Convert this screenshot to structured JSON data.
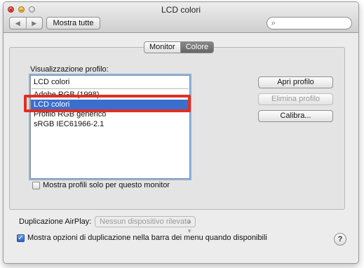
{
  "window": {
    "title": "LCD colori"
  },
  "toolbar": {
    "back_icon": "triangle-left",
    "forward_icon": "triangle-right",
    "show_all_label": "Mostra tutte",
    "search_placeholder": "",
    "search_icon": "magnifier"
  },
  "tabs": {
    "items": [
      {
        "label": "Monitor"
      },
      {
        "label": "Colore"
      }
    ],
    "selected": "Colore"
  },
  "profiles": {
    "label": "Visualizzazione profilo:",
    "current": "LCD colori",
    "items": [
      {
        "label": "Adobe RGB (1998)"
      },
      {
        "label": "LCD colori"
      },
      {
        "label": "Profilo RGB generico"
      },
      {
        "label": "sRGB IEC61966-2.1"
      }
    ],
    "selected_index": 1
  },
  "buttons": {
    "open_profile": "Apri profilo",
    "delete_profile": "Elimina profilo",
    "calibrate": "Calibra..."
  },
  "options": {
    "only_this_monitor_label": "Mostra profili solo per questo monitor",
    "only_this_monitor_checked": false,
    "airplay_label": "Duplicazione AirPlay:",
    "airplay_value": "Nessun dispositivo rilevato",
    "menu_bar_label": "Mostra opzioni di duplicazione nella barra dei menu quando disponibili",
    "menu_bar_checked": true
  },
  "help": {
    "label": "?"
  },
  "colors": {
    "accent": "#3a6fd0",
    "highlight": "#e03020"
  }
}
